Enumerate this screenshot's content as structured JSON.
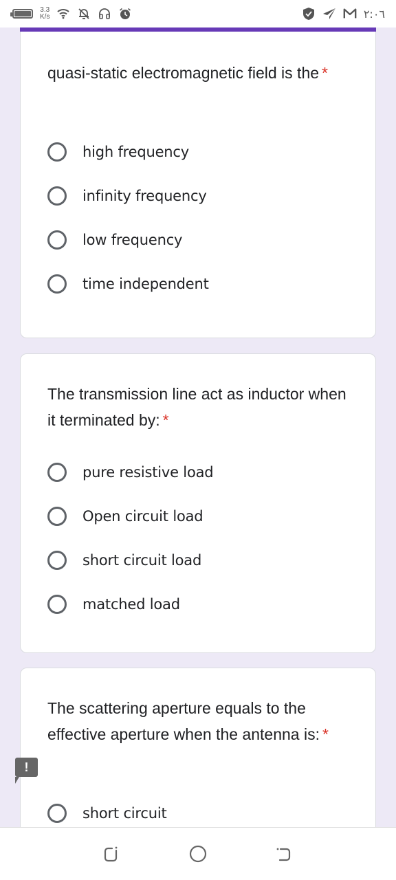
{
  "status_bar": {
    "network_speed_value": "3.3",
    "network_speed_unit": "K/s",
    "time": "٢:٠٦",
    "icons_left": [
      "battery-icon",
      "wifi-icon",
      "bell-off-icon",
      "headphones-icon",
      "alarm-icon"
    ],
    "icons_right": [
      "shield-check-icon",
      "telegram-icon",
      "gmail-icon"
    ]
  },
  "form": {
    "accent_color": "#673ab7",
    "required_marker": "*",
    "questions": [
      {
        "text": "quasi-static electromagnetic field is the",
        "required": true,
        "options": [
          "high frequency",
          "infinity frequency",
          "low frequency",
          "time independent"
        ]
      },
      {
        "text": "The transmission line act as inductor when it terminated by:",
        "required": true,
        "options": [
          "pure resistive load",
          "Open circuit load",
          "short circuit load",
          "matched load"
        ]
      },
      {
        "text": "The scattering aperture equals to the effective aperture when the antenna is:",
        "required": true,
        "options": [
          "short circuit"
        ]
      }
    ]
  },
  "feedback": {
    "label": "!"
  },
  "nav_bar": {
    "buttons": [
      "recents",
      "home",
      "back"
    ]
  }
}
